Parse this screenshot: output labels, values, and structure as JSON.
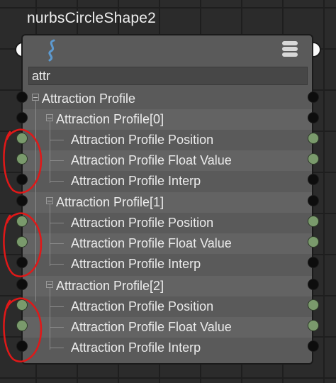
{
  "node": {
    "title": "nurbsCircleShape2",
    "filter_value": "attr",
    "icons": {
      "shape": "curve-shape-icon",
      "menu": "node-menu-icon"
    }
  },
  "attributes": {
    "root": "Attraction Profile",
    "groups": [
      {
        "label": "Attraction Profile[0]",
        "children": [
          "Attraction Profile Position",
          "Attraction Profile Float Value",
          "Attraction Profile Interp"
        ]
      },
      {
        "label": "Attraction Profile[1]",
        "children": [
          "Attraction Profile Position",
          "Attraction Profile Float Value",
          "Attraction Profile Interp"
        ]
      },
      {
        "label": "Attraction Profile[2]",
        "children": [
          "Attraction Profile Position",
          "Attraction Profile Float Value",
          "Attraction Profile Interp"
        ]
      }
    ]
  },
  "colors": {
    "node_body": "#5a5a5a",
    "port_connected": "#7a9a6c",
    "port_unconnected": "#0d0d0d",
    "annotation_circle": "#e01818"
  }
}
